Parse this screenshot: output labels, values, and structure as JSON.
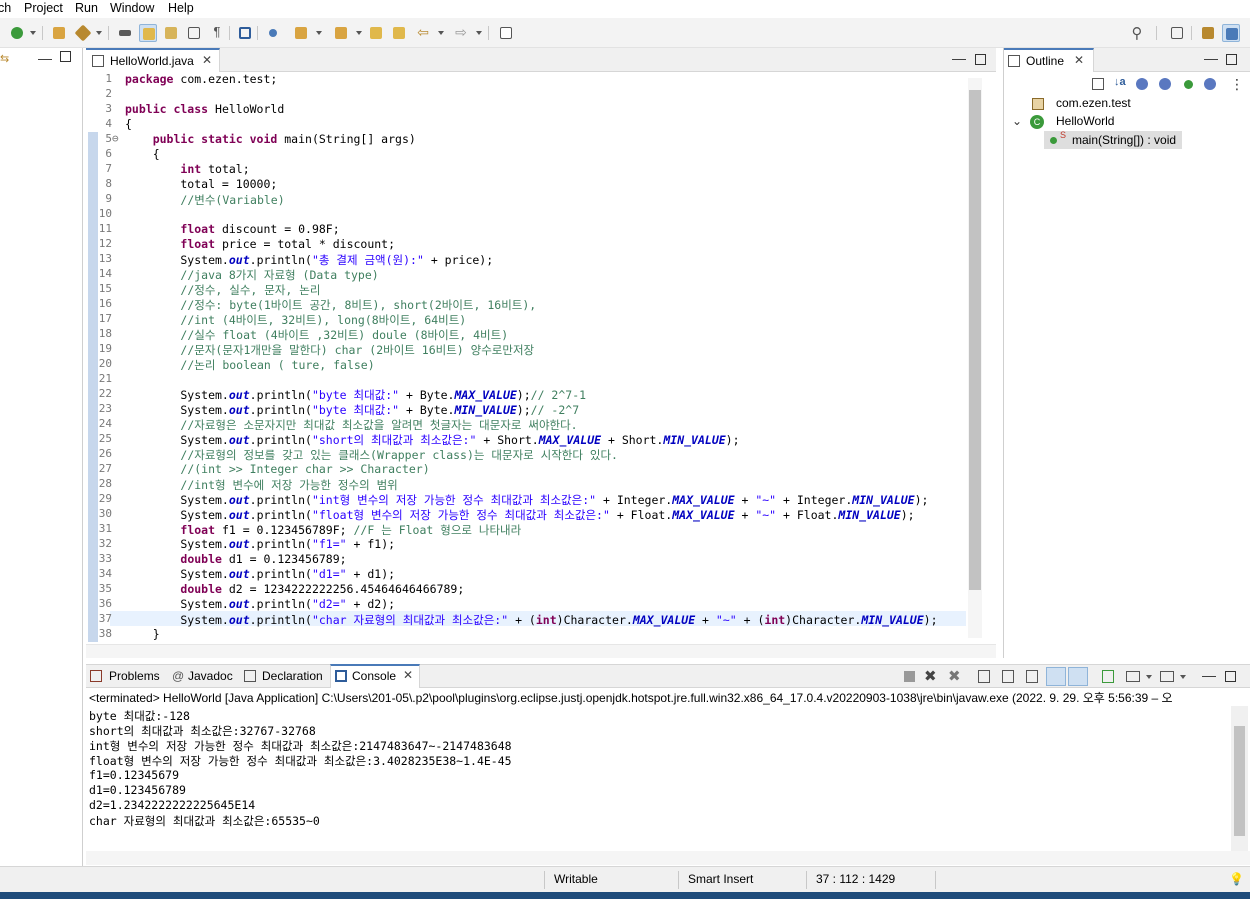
{
  "menubar": {
    "items": [
      "ch",
      "Project",
      "Run",
      "Window",
      "Help"
    ]
  },
  "toolbar": {
    "icons": [
      "run-icon",
      "debug-icon",
      "open-type-icon",
      "build-icon",
      "highlight-icon",
      "annotation-icon",
      "toggle-pilcrow-icon",
      "console-icon",
      "search-icon",
      "perspective-icon",
      "java-perspective-icon"
    ]
  },
  "editor": {
    "tab_label": "HelloWorld.java",
    "lines": [
      {
        "n": "1",
        "fold": false
      },
      {
        "n": "2",
        "fold": false
      },
      {
        "n": "3",
        "fold": false
      },
      {
        "n": "4",
        "fold": false
      },
      {
        "n": "5",
        "fold": true
      },
      {
        "n": "6",
        "fold": false
      },
      {
        "n": "7",
        "fold": false
      },
      {
        "n": "8",
        "fold": false
      },
      {
        "n": "9",
        "fold": false
      },
      {
        "n": "10",
        "fold": false
      },
      {
        "n": "11",
        "fold": false
      },
      {
        "n": "12",
        "fold": false
      },
      {
        "n": "13",
        "fold": false
      },
      {
        "n": "14",
        "fold": false
      },
      {
        "n": "15",
        "fold": false
      },
      {
        "n": "16",
        "fold": false
      },
      {
        "n": "17",
        "fold": false
      },
      {
        "n": "18",
        "fold": false
      },
      {
        "n": "19",
        "fold": false
      },
      {
        "n": "20",
        "fold": false
      },
      {
        "n": "21",
        "fold": false
      },
      {
        "n": "22",
        "fold": false
      },
      {
        "n": "23",
        "fold": false
      },
      {
        "n": "24",
        "fold": false
      },
      {
        "n": "25",
        "fold": false
      },
      {
        "n": "26",
        "fold": false
      },
      {
        "n": "27",
        "fold": false
      },
      {
        "n": "28",
        "fold": false
      },
      {
        "n": "29",
        "fold": false
      },
      {
        "n": "30",
        "fold": false
      },
      {
        "n": "31",
        "fold": false
      },
      {
        "n": "32",
        "fold": false
      },
      {
        "n": "33",
        "fold": false
      },
      {
        "n": "34",
        "fold": false
      },
      {
        "n": "35",
        "fold": false
      },
      {
        "n": "36",
        "fold": false
      },
      {
        "n": "37",
        "fold": false
      },
      {
        "n": "38",
        "fold": false
      }
    ],
    "code": [
      [
        [
          "kw",
          "package"
        ],
        [
          "t",
          " com.ezen.test;"
        ]
      ],
      [],
      [
        [
          "kw",
          "public class"
        ],
        [
          "t",
          " HelloWorld"
        ]
      ],
      [
        [
          "t",
          "{"
        ]
      ],
      [
        [
          "t",
          "    "
        ],
        [
          "kw",
          "public static void"
        ],
        [
          "t",
          " main(String[] args)"
        ]
      ],
      [
        [
          "t",
          "    {"
        ]
      ],
      [
        [
          "t",
          "        "
        ],
        [
          "kw",
          "int"
        ],
        [
          "t",
          " total;"
        ]
      ],
      [
        [
          "t",
          "        total = 10000;"
        ]
      ],
      [
        [
          "t",
          "        "
        ],
        [
          "cm",
          "//변수(Variable)"
        ]
      ],
      [],
      [
        [
          "t",
          "        "
        ],
        [
          "kw",
          "float"
        ],
        [
          "t",
          " discount = 0.98F;"
        ]
      ],
      [
        [
          "t",
          "        "
        ],
        [
          "kw",
          "float"
        ],
        [
          "t",
          " price = total * discount;"
        ]
      ],
      [
        [
          "t",
          "        System."
        ],
        [
          "fld",
          "out"
        ],
        [
          "t",
          ".println("
        ],
        [
          "st",
          "\"총 결제 금액(원):\""
        ],
        [
          "t",
          " + price);"
        ]
      ],
      [
        [
          "t",
          "        "
        ],
        [
          "cm",
          "//java 8가지 자료형 (Data type)"
        ]
      ],
      [
        [
          "t",
          "        "
        ],
        [
          "cm",
          "//정수, 실수, 문자, 논리"
        ]
      ],
      [
        [
          "t",
          "        "
        ],
        [
          "cm",
          "//정수: byte(1바이트 공간, 8비트), short(2바이트, 16비트),"
        ]
      ],
      [
        [
          "t",
          "        "
        ],
        [
          "cm",
          "//int (4바이트, 32비트), long(8바이트, 64비트)"
        ]
      ],
      [
        [
          "t",
          "        "
        ],
        [
          "cm",
          "//실수 float (4바이트 ,32비트) doule (8바이트, 4비트)"
        ]
      ],
      [
        [
          "t",
          "        "
        ],
        [
          "cm",
          "//문자(문자1개만을 말한다) char (2바이트 16비트) 양수로만저장"
        ]
      ],
      [
        [
          "t",
          "        "
        ],
        [
          "cm",
          "//논리 boolean ( ture, false)"
        ]
      ],
      [],
      [
        [
          "t",
          "        System."
        ],
        [
          "fld",
          "out"
        ],
        [
          "t",
          ".println("
        ],
        [
          "st",
          "\"byte 최대값:\""
        ],
        [
          "t",
          " + Byte."
        ],
        [
          "fld",
          "MAX_VALUE"
        ],
        [
          "t",
          ");"
        ],
        [
          "cm",
          "// 2^7-1"
        ]
      ],
      [
        [
          "t",
          "        System."
        ],
        [
          "fld",
          "out"
        ],
        [
          "t",
          ".println("
        ],
        [
          "st",
          "\"byte 최대값:\""
        ],
        [
          "t",
          " + Byte."
        ],
        [
          "fld",
          "MIN_VALUE"
        ],
        [
          "t",
          ");"
        ],
        [
          "cm",
          "// -2^7"
        ]
      ],
      [
        [
          "t",
          "        "
        ],
        [
          "cm",
          "//자료형은 소문자지만 최대값 최소값을 알려면 첫글자는 대문자로 써야한다."
        ]
      ],
      [
        [
          "t",
          "        System."
        ],
        [
          "fld",
          "out"
        ],
        [
          "t",
          ".println("
        ],
        [
          "st",
          "\"short의 최대값과 최소값은:\""
        ],
        [
          "t",
          " + Short."
        ],
        [
          "fld",
          "MAX_VALUE"
        ],
        [
          "t",
          " + Short."
        ],
        [
          "fld",
          "MIN_VALUE"
        ],
        [
          "t",
          ");"
        ]
      ],
      [
        [
          "t",
          "        "
        ],
        [
          "cm",
          "//자료형의 정보를 갖고 있는 클래스(Wrapper class)는 대문자로 시작한다 있다."
        ]
      ],
      [
        [
          "t",
          "        "
        ],
        [
          "cm",
          "//(int >> Integer char >> Character)"
        ]
      ],
      [
        [
          "t",
          "        "
        ],
        [
          "cm",
          "//int형 변수에 저장 가능한 정수의 범위"
        ]
      ],
      [
        [
          "t",
          "        System."
        ],
        [
          "fld",
          "out"
        ],
        [
          "t",
          ".println("
        ],
        [
          "st",
          "\"int형 변수의 저장 가능한 정수 최대값과 최소값은:\""
        ],
        [
          "t",
          " + Integer."
        ],
        [
          "fld",
          "MAX_VALUE"
        ],
        [
          "t",
          " + "
        ],
        [
          "st",
          "\"~\""
        ],
        [
          "t",
          " + Integer."
        ],
        [
          "fld",
          "MIN_VALUE"
        ],
        [
          "t",
          ");"
        ]
      ],
      [
        [
          "t",
          "        System."
        ],
        [
          "fld",
          "out"
        ],
        [
          "t",
          ".println("
        ],
        [
          "st",
          "\"float형 변수의 저장 가능한 정수 최대값과 최소값은:\""
        ],
        [
          "t",
          " + Float."
        ],
        [
          "fld",
          "MAX_VALUE"
        ],
        [
          "t",
          " + "
        ],
        [
          "st",
          "\"~\""
        ],
        [
          "t",
          " + Float."
        ],
        [
          "fld",
          "MIN_VALUE"
        ],
        [
          "t",
          ");"
        ]
      ],
      [
        [
          "t",
          "        "
        ],
        [
          "kw",
          "float"
        ],
        [
          "t",
          " f1 = 0.123456789F; "
        ],
        [
          "cm",
          "//F 는 Float 형으로 나타내라"
        ]
      ],
      [
        [
          "t",
          "        System."
        ],
        [
          "fld",
          "out"
        ],
        [
          "t",
          ".println("
        ],
        [
          "st",
          "\"f1=\""
        ],
        [
          "t",
          " + f1);"
        ]
      ],
      [
        [
          "t",
          "        "
        ],
        [
          "kw",
          "double"
        ],
        [
          "t",
          " d1 = 0.123456789;"
        ]
      ],
      [
        [
          "t",
          "        System."
        ],
        [
          "fld",
          "out"
        ],
        [
          "t",
          ".println("
        ],
        [
          "st",
          "\"d1=\""
        ],
        [
          "t",
          " + d1);"
        ]
      ],
      [
        [
          "t",
          "        "
        ],
        [
          "kw",
          "double"
        ],
        [
          "t",
          " d2 = 1234222222256.45464646466789;"
        ]
      ],
      [
        [
          "t",
          "        System."
        ],
        [
          "fld",
          "out"
        ],
        [
          "t",
          ".println("
        ],
        [
          "st",
          "\"d2=\""
        ],
        [
          "t",
          " + d2);"
        ]
      ],
      [
        [
          "t",
          "        System."
        ],
        [
          "fld",
          "out"
        ],
        [
          "t",
          ".println("
        ],
        [
          "st",
          "\"char 자료형의 최대값과 최소값은:\""
        ],
        [
          "t",
          " + ("
        ],
        [
          "kw",
          "int"
        ],
        [
          "t",
          ")Character."
        ],
        [
          "fld",
          "MAX_VALUE"
        ],
        [
          "t",
          " + "
        ],
        [
          "st",
          "\"~\""
        ],
        [
          "t",
          " + ("
        ],
        [
          "kw",
          "int"
        ],
        [
          "t",
          ")Character."
        ],
        [
          "fld",
          "MIN_VALUE"
        ],
        [
          "t",
          ");"
        ]
      ],
      [
        [
          "t",
          "    }"
        ]
      ]
    ]
  },
  "outline": {
    "tab_label": "Outline",
    "package": "com.ezen.test",
    "class_name": "HelloWorld",
    "method": "main(String[]) : void"
  },
  "console_tabs": [
    {
      "name": "problems",
      "label": "Problems"
    },
    {
      "name": "javadoc",
      "label": "Javadoc"
    },
    {
      "name": "declaration",
      "label": "Declaration"
    },
    {
      "name": "console",
      "label": "Console"
    }
  ],
  "console": {
    "status": "<terminated> HelloWorld [Java Application] C:\\Users\\201-05\\.p2\\pool\\plugins\\org.eclipse.justj.openjdk.hotspot.jre.full.win32.x86_64_17.0.4.v20220903-1038\\jre\\bin\\javaw.exe  (2022. 9. 29. 오후 5:56:39 – 오",
    "output": [
      "byte 최대값:-128",
      "short의 최대값과 최소값은:32767-32768",
      "int형 변수의 저장 가능한 정수 최대값과 최소값은:2147483647~-2147483648",
      "float형 변수의 저장 가능한 정수 최대값과 최소값은:3.4028235E38~1.4E-45",
      "f1=0.12345679",
      "d1=0.123456789",
      "d2=1.2342222222225645E14",
      "char 자료형의 최대값과 최소값은:65535~0"
    ]
  },
  "statusbar": {
    "writable": "Writable",
    "insert_mode": "Smart Insert",
    "position": "37 : 112 : 1429"
  }
}
